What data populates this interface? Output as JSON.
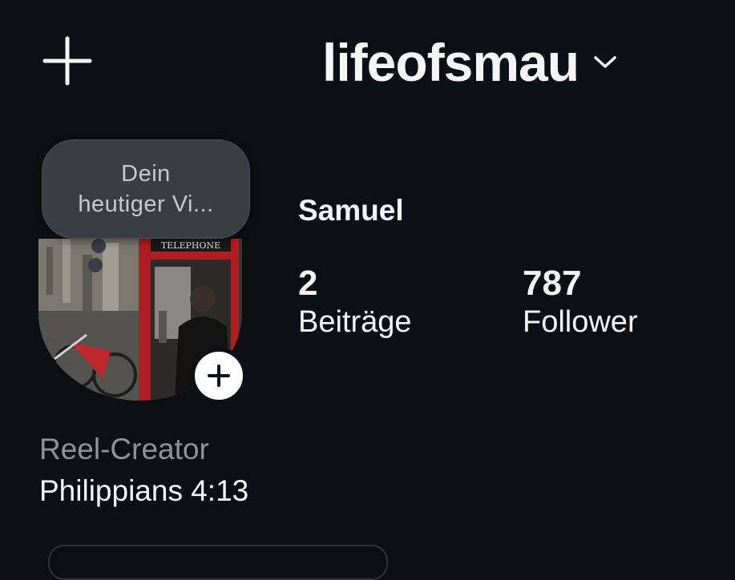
{
  "header": {
    "username": "lifeofsmau",
    "add_icon": "plus-icon",
    "dropdown_icon": "chevron-down-icon"
  },
  "note": {
    "text_line1": "Dein",
    "text_line2": "heutiger Vi..."
  },
  "avatar": {
    "sign_text": "TELEPHONE",
    "add_story_icon": "plus-icon"
  },
  "profile": {
    "display_name": "Samuel",
    "stats": [
      {
        "value": "2",
        "label": "Beiträge"
      },
      {
        "value": "787",
        "label": "Follower"
      }
    ],
    "category": "Reel-Creator",
    "bio": "Philippians 4:13"
  },
  "colors": {
    "background": "#0c1014",
    "text": "#f5f5f5",
    "muted": "#8e9398",
    "bubble": "#3a3e44"
  }
}
